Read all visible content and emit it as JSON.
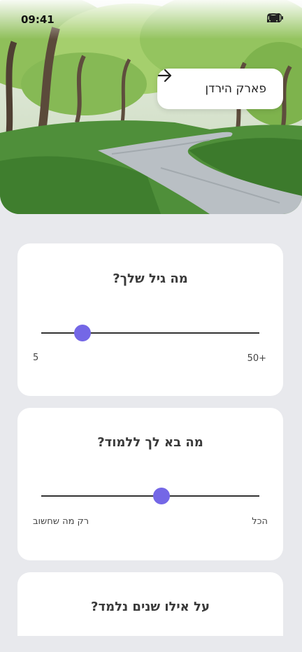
{
  "status_bar": {
    "time": "09:41"
  },
  "hero": {
    "place_name": "פארק הירדן",
    "arrow_icon": "arrow-right-icon"
  },
  "questions": [
    {
      "title": "מה גיל שלך?",
      "left_label": "5",
      "right_label": "50+",
      "value_fraction": 0.19
    },
    {
      "title": "מה בא לך ללמוד?",
      "left_label": "רק מה שחשוב",
      "right_label": "הכל",
      "value_fraction": 0.55
    },
    {
      "title": "על אילו שנים נלמד?"
    }
  ],
  "colors": {
    "accent": "#7467e6",
    "background": "#e8e9ed"
  }
}
